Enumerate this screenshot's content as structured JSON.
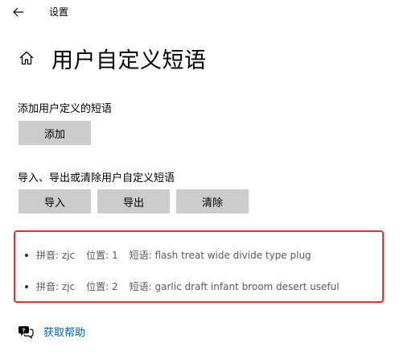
{
  "window": {
    "title": "设置",
    "back_icon": "arrow-left-icon"
  },
  "page": {
    "title": "用户自定义短语",
    "home_icon": "home-icon"
  },
  "add_section": {
    "label": "添加用户定义的短语",
    "add_button": "添加"
  },
  "io_section": {
    "label": "导入、导出或清除用户自定义短语",
    "import_button": "导入",
    "export_button": "导出",
    "clear_button": "清除"
  },
  "phrases": [
    {
      "pinyin_label": "拼音:",
      "pinyin": "zjc",
      "position_label": "位置:",
      "position": "1",
      "phrase_label": "短语:",
      "phrase": "flash treat wide divide type plug"
    },
    {
      "pinyin_label": "拼音:",
      "pinyin": "zjc",
      "position_label": "位置:",
      "position": "2",
      "phrase_label": "短语:",
      "phrase": "garlic draft infant broom desert useful"
    }
  ],
  "help": {
    "label": "获取帮助",
    "icon": "help-chat-icon"
  },
  "colors": {
    "button_bg": "#cccccc",
    "link": "#0063b1",
    "highlight_border": "#e8302a"
  }
}
